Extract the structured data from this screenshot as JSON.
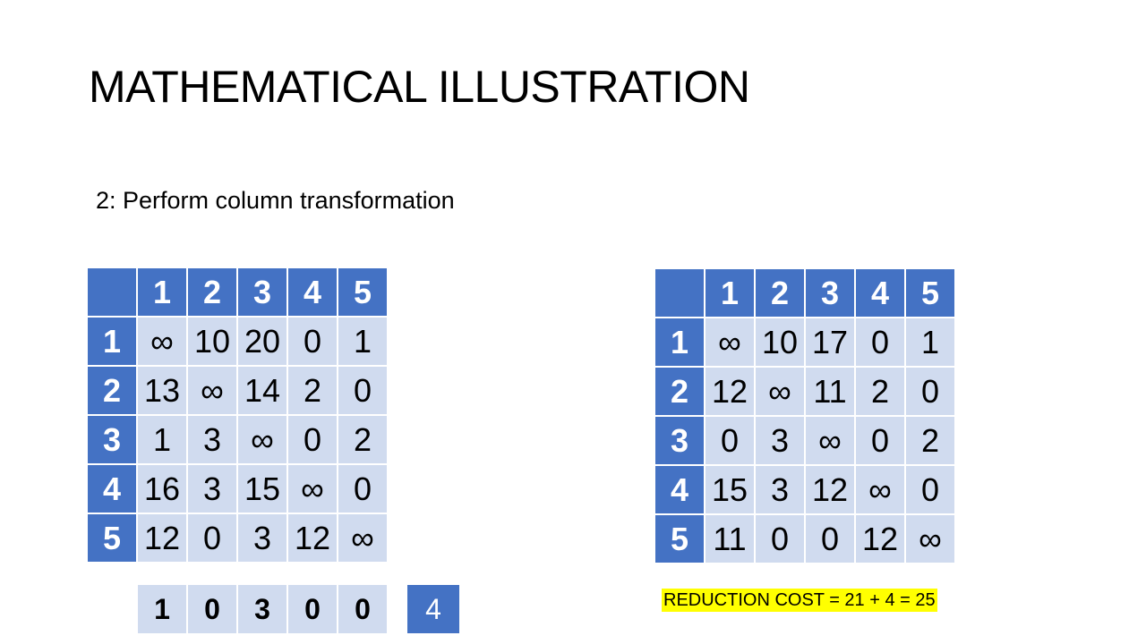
{
  "slide": {
    "title": "MATHEMATICAL ILLUSTRATION",
    "subtitle": "2: Perform column transformation"
  },
  "left_matrix": {
    "column_headers": [
      "1",
      "2",
      "3",
      "4",
      "5"
    ],
    "rows": [
      {
        "label": "1",
        "cells": [
          "∞",
          "10",
          "20",
          "0",
          "1"
        ]
      },
      {
        "label": "2",
        "cells": [
          "13",
          "∞",
          "14",
          "2",
          "0"
        ]
      },
      {
        "label": "3",
        "cells": [
          "1",
          "3",
          "∞",
          "0",
          "2"
        ]
      },
      {
        "label": "4",
        "cells": [
          "16",
          "3",
          "15",
          "∞",
          "0"
        ]
      },
      {
        "label": "5",
        "cells": [
          "12",
          "0",
          "3",
          "12",
          "∞"
        ]
      }
    ]
  },
  "column_reduction": {
    "values": [
      "1",
      "0",
      "3",
      "0",
      "0"
    ],
    "total": "4"
  },
  "right_matrix": {
    "column_headers": [
      "1",
      "2",
      "3",
      "4",
      "5"
    ],
    "rows": [
      {
        "label": "1",
        "cells": [
          "∞",
          "10",
          "17",
          "0",
          "1"
        ]
      },
      {
        "label": "2",
        "cells": [
          "12",
          "∞",
          "11",
          "2",
          "0"
        ]
      },
      {
        "label": "3",
        "cells": [
          "0",
          "3",
          "∞",
          "0",
          "2"
        ]
      },
      {
        "label": "4",
        "cells": [
          "15",
          "3",
          "12",
          "∞",
          "0"
        ]
      },
      {
        "label": "5",
        "cells": [
          "11",
          "0",
          "0",
          "12",
          "∞"
        ]
      }
    ]
  },
  "reduction_cost_label": "REDUCTION COST = 21 + 4 = 25",
  "colors": {
    "header_blue": "#4472c4",
    "cell_light_blue": "#d0dbef",
    "highlight_yellow": "#ffff00"
  }
}
